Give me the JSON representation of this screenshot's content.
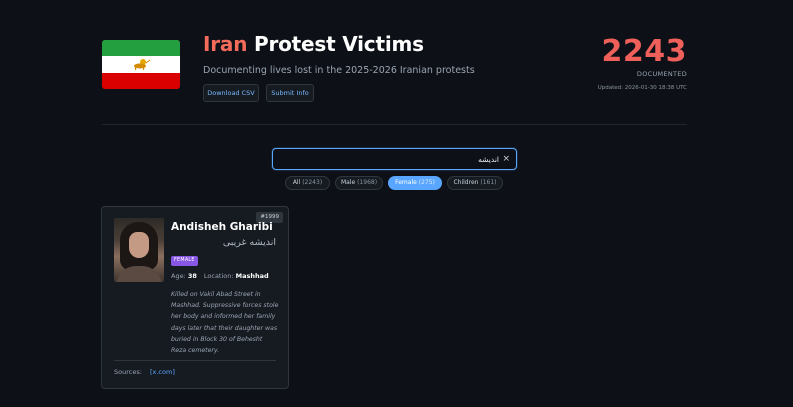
{
  "header": {
    "title_accent": "Iran",
    "title_rest": " Protest Victims",
    "subtitle": "Documenting lives lost in the 2025-2026 Iranian protests",
    "download_label": "Download CSV",
    "submit_label": "Submit Info",
    "count": "2243",
    "count_label": "DOCUMENTED",
    "updated": "Updated: 2026-01-30 18:38 UTC"
  },
  "search": {
    "value": "اندیشه",
    "clear": "×"
  },
  "filters": [
    {
      "label": "All",
      "count": "(2243)",
      "active": false
    },
    {
      "label": "Male",
      "count": "(1968)",
      "active": false
    },
    {
      "label": "Female",
      "count": "(275)",
      "active": true
    },
    {
      "label": "Children",
      "count": "(161)",
      "active": false
    }
  ],
  "card": {
    "id": "#1999",
    "name": "Andisheh Gharibi",
    "name_fa": "اندیشه غریبی",
    "gender": "FEMALE",
    "age_label": "Age:",
    "age": "38",
    "location_label": "Location:",
    "location": "Mashhad",
    "description": "Killed on Vakil Abad Street in Mashhad. Suppressive forces stole her body and informed her family days later that their daughter was buried in Block 30 of Behesht Reza cemetery.",
    "sources_label": "Sources:",
    "source_link": "[x.com]"
  },
  "colors": {
    "background": "#0d1117",
    "accent_red": "#f0605a",
    "link_blue": "#58a6ff",
    "female_badge": "#8957e5"
  }
}
